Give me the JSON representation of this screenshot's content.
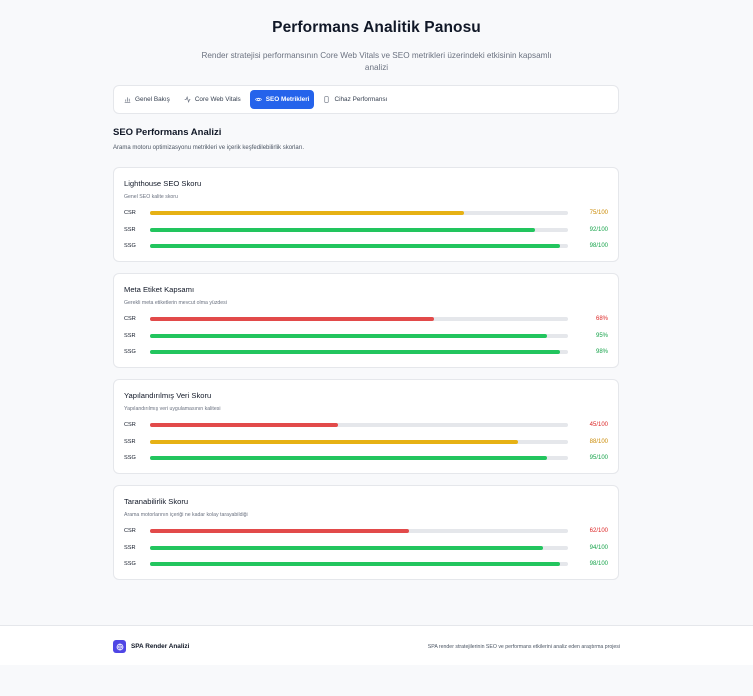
{
  "header": {
    "title": "Performans Analitik Panosu",
    "subtitle": "Render stratejisi performansının Core Web Vitals ve SEO metrikleri üzerindeki etkisinin kapsamlı analizi"
  },
  "tabs": [
    {
      "label": "Genel Bakış",
      "icon": "bar-chart-icon",
      "active": false
    },
    {
      "label": "Core Web Vitals",
      "icon": "activity-icon",
      "active": false
    },
    {
      "label": "SEO Metrikleri",
      "icon": "eye-icon",
      "active": true
    },
    {
      "label": "Cihaz Performansı",
      "icon": "smartphone-icon",
      "active": false
    }
  ],
  "section": {
    "title": "SEO Performans Analizi",
    "description": "Arama motoru optimizasyonu metrikleri ve içerik keşfedilebilirlik skorları."
  },
  "colors": {
    "red": "#e24a4a",
    "yellow": "#e6b114",
    "green": "#22c55e",
    "accent": "#2563eb"
  },
  "cards": [
    {
      "title": "Lighthouse SEO Skoru",
      "description": "Genel SEO kalite skoru",
      "rows": [
        {
          "label": "CSR",
          "value": 75,
          "display": "75/100",
          "status": "yellow"
        },
        {
          "label": "SSR",
          "value": 92,
          "display": "92/100",
          "status": "green"
        },
        {
          "label": "SSG",
          "value": 98,
          "display": "98/100",
          "status": "green"
        }
      ]
    },
    {
      "title": "Meta Etiket Kapsamı",
      "description": "Gerekli meta etiketlerin mevcut olma yüzdesi",
      "rows": [
        {
          "label": "CSR",
          "value": 68,
          "display": "68%",
          "status": "red"
        },
        {
          "label": "SSR",
          "value": 95,
          "display": "95%",
          "status": "green"
        },
        {
          "label": "SSG",
          "value": 98,
          "display": "98%",
          "status": "green"
        }
      ]
    },
    {
      "title": "Yapılandırılmış Veri Skoru",
      "description": "Yapılandırılmış veri uygulamasının kalitesi",
      "rows": [
        {
          "label": "CSR",
          "value": 45,
          "display": "45/100",
          "status": "red"
        },
        {
          "label": "SSR",
          "value": 88,
          "display": "88/100",
          "status": "yellow"
        },
        {
          "label": "SSG",
          "value": 95,
          "display": "95/100",
          "status": "green"
        }
      ]
    },
    {
      "title": "Taranabilirlik Skoru",
      "description": "Arama motorlarının içeriği ne kadar kolay tarayabildiği",
      "rows": [
        {
          "label": "CSR",
          "value": 62,
          "display": "62/100",
          "status": "red"
        },
        {
          "label": "SSR",
          "value": 94,
          "display": "94/100",
          "status": "green"
        },
        {
          "label": "SSG",
          "value": 98,
          "display": "98/100",
          "status": "green"
        }
      ]
    }
  ],
  "footer": {
    "app_name": "SPA Render Analizi",
    "note": "SPA render stratejilerinin SEO ve performans etkilerini analiz eden araştırma projesi"
  }
}
